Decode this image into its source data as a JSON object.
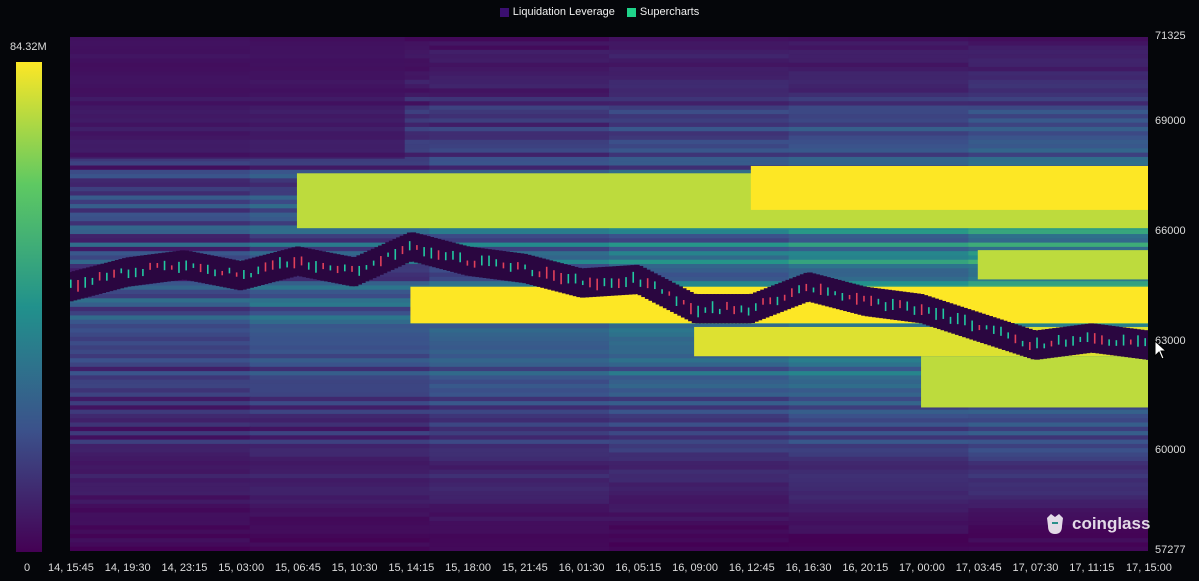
{
  "legend": [
    {
      "label": "Liquidation Leverage",
      "color": "#3b0f70"
    },
    {
      "label": "Supercharts",
      "color": "#1fd38a"
    }
  ],
  "colorbar": {
    "max_label": "84.32M",
    "min_label": "0"
  },
  "watermark": {
    "text": "coinglass",
    "icon": "coinglass-logo-icon"
  },
  "chart_data": {
    "type": "heatmap",
    "title": "",
    "colorscale": "viridis",
    "legend_placement": "top-center",
    "y_axis": {
      "ticks": [
        "71325",
        "69000",
        "66000",
        "63000",
        "60000",
        "57277"
      ],
      "range": [
        57277,
        71325
      ]
    },
    "x_axis": {
      "ticks": [
        "14, 15:45",
        "14, 19:30",
        "14, 23:15",
        "15, 03:00",
        "15, 06:45",
        "15, 10:30",
        "15, 14:15",
        "15, 18:00",
        "15, 21:45",
        "16, 01:30",
        "16, 05:15",
        "16, 09:00",
        "16, 12:45",
        "16, 16:30",
        "16, 20:15",
        "17, 00:00",
        "17, 03:45",
        "17, 07:30",
        "17, 11:15",
        "17, 15:00"
      ]
    },
    "heat_bands": [
      {
        "price_low": 66100,
        "price_high": 67600,
        "start_index": 4,
        "intensity": 0.9
      },
      {
        "price_low": 66600,
        "price_high": 67800,
        "start_index": 12,
        "intensity": 1.0
      },
      {
        "price_low": 63500,
        "price_high": 64500,
        "start_index": 6,
        "intensity": 1.0
      },
      {
        "price_low": 62600,
        "price_high": 63400,
        "start_index": 11,
        "intensity": 0.95
      },
      {
        "price_low": 61200,
        "price_high": 62600,
        "start_index": 15,
        "intensity": 0.9
      },
      {
        "price_low": 64700,
        "price_high": 65500,
        "start_index": 16,
        "intensity": 0.9
      }
    ],
    "price_series": [
      {
        "x": "14, 15:45",
        "price": 64500
      },
      {
        "x": "14, 19:30",
        "price": 64900
      },
      {
        "x": "14, 23:15",
        "price": 65100
      },
      {
        "x": "15, 03:00",
        "price": 64800
      },
      {
        "x": "15, 06:45",
        "price": 65200
      },
      {
        "x": "15, 10:30",
        "price": 64900
      },
      {
        "x": "15, 14:15",
        "price": 65600
      },
      {
        "x": "15, 18:00",
        "price": 65200
      },
      {
        "x": "15, 21:45",
        "price": 65000
      },
      {
        "x": "16, 01:30",
        "price": 64600
      },
      {
        "x": "16, 05:15",
        "price": 64700
      },
      {
        "x": "16, 09:00",
        "price": 63900
      },
      {
        "x": "16, 12:45",
        "price": 63900
      },
      {
        "x": "16, 16:30",
        "price": 64500
      },
      {
        "x": "16, 20:15",
        "price": 64100
      },
      {
        "x": "17, 00:00",
        "price": 63900
      },
      {
        "x": "17, 03:45",
        "price": 63400
      },
      {
        "x": "17, 07:30",
        "price": 62900
      },
      {
        "x": "17, 11:15",
        "price": 63100
      },
      {
        "x": "17, 15:00",
        "price": 62900
      }
    ]
  }
}
